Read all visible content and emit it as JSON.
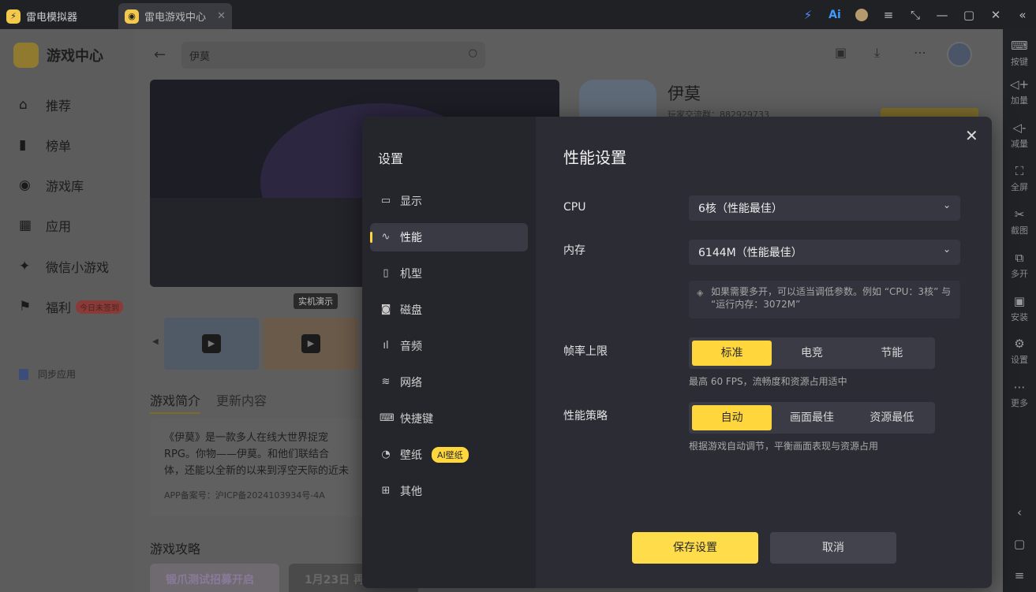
{
  "window": {
    "tabs": [
      {
        "label": "雷电模拟器"
      },
      {
        "label": "雷电游戏中心"
      }
    ],
    "title_icons": [
      "bolt-icon",
      "ai-icon",
      "avatar-icon",
      "menu-icon",
      "shrink-icon",
      "minimize-icon",
      "maximize-icon",
      "close-icon",
      "collapse-icon"
    ],
    "ai_label": "Ai"
  },
  "rightbar": {
    "items": [
      {
        "label": "按键",
        "icon": "keyboard-icon",
        "glyph": "⌨"
      },
      {
        "label": "加量",
        "icon": "volume-up-icon",
        "glyph": "◁+"
      },
      {
        "label": "减量",
        "icon": "volume-down-icon",
        "glyph": "◁-"
      },
      {
        "label": "全屏",
        "icon": "fullscreen-icon",
        "glyph": "⛶"
      },
      {
        "label": "截图",
        "icon": "scissors-icon",
        "glyph": "✂"
      },
      {
        "label": "多开",
        "icon": "multi-instance-icon",
        "glyph": "⧉"
      },
      {
        "label": "安装",
        "icon": "apk-install-icon",
        "glyph": "▣"
      },
      {
        "label": "设置",
        "icon": "settings-icon",
        "glyph": "⚙"
      },
      {
        "label": "更多",
        "icon": "more-icon",
        "glyph": "⋯"
      }
    ],
    "bottom": [
      {
        "icon": "back-icon",
        "glyph": "‹"
      },
      {
        "icon": "home-icon",
        "glyph": "▢"
      },
      {
        "icon": "recent-apps-icon",
        "glyph": "≡"
      }
    ]
  },
  "sidebar": {
    "brand": "游戏中心",
    "items": [
      {
        "label": "推荐",
        "icon": "home-icon",
        "glyph": "⌂"
      },
      {
        "label": "榜单",
        "icon": "chart-icon",
        "glyph": "▮"
      },
      {
        "label": "游戏库",
        "icon": "gamepad-icon",
        "glyph": "◉"
      },
      {
        "label": "应用",
        "icon": "apps-icon",
        "glyph": "▦"
      },
      {
        "label": "微信小游戏",
        "icon": "mini-game-icon",
        "glyph": "✦"
      },
      {
        "label": "福利",
        "icon": "gift-icon",
        "glyph": "⚑",
        "badge": "今日未签到"
      }
    ],
    "sync": "同步应用"
  },
  "header": {
    "search_value": "伊莫"
  },
  "game": {
    "name": "伊莫",
    "sub": "玩家交流群：882929733",
    "demo_tag": "实机演示",
    "tabs": [
      "游戏简介",
      "更新内容"
    ],
    "intro": "《伊莫》是一款多人在线大世界捉宠RPG。你物——伊莫。和他们联结合体，还能以全新的以来到浮空天际的近未来都市，邂逅其他冒险",
    "icp": "APP备案号：沪ICP备2024103934号-4A",
    "guide_title": "游戏攻略",
    "guide_cards": [
      "锻爪测试招募开启",
      "1月23日 再"
    ]
  },
  "settings": {
    "title": "设置",
    "nav": [
      {
        "label": "显示",
        "icon": "display-icon",
        "glyph": "▭"
      },
      {
        "label": "性能",
        "icon": "performance-icon",
        "glyph": "∿",
        "active": true
      },
      {
        "label": "机型",
        "icon": "phone-icon",
        "glyph": "▯"
      },
      {
        "label": "磁盘",
        "icon": "disk-icon",
        "glyph": "◙"
      },
      {
        "label": "音频",
        "icon": "audio-icon",
        "glyph": "ıl"
      },
      {
        "label": "网络",
        "icon": "wifi-icon",
        "glyph": "≋"
      },
      {
        "label": "快捷键",
        "icon": "keyboard-icon",
        "glyph": "⌨"
      },
      {
        "label": "壁纸",
        "icon": "palette-icon",
        "glyph": "◔",
        "badge": "AI壁纸"
      },
      {
        "label": "其他",
        "icon": "grid-icon",
        "glyph": "⊞"
      }
    ],
    "panel_title": "性能设置",
    "cpu": {
      "label": "CPU",
      "value": "6核（性能最佳）"
    },
    "memory": {
      "label": "内存",
      "value": "6144M（性能最佳）"
    },
    "tip": "如果需要多开，可以适当调低参数。例如 “CPU：3核” 与 “运行内存：3072M”",
    "fps": {
      "label": "帧率上限",
      "options": [
        "标准",
        "电竞",
        "节能"
      ],
      "selected": "标准",
      "hint": "最高 60 FPS，流畅度和资源占用适中"
    },
    "strategy": {
      "label": "性能策略",
      "options": [
        "自动",
        "画面最佳",
        "资源最低"
      ],
      "selected": "自动",
      "hint": "根据游戏自动调节，平衡画面表现与资源占用"
    },
    "save_label": "保存设置",
    "cancel_label": "取消",
    "accent_color": "#ffd73d"
  }
}
